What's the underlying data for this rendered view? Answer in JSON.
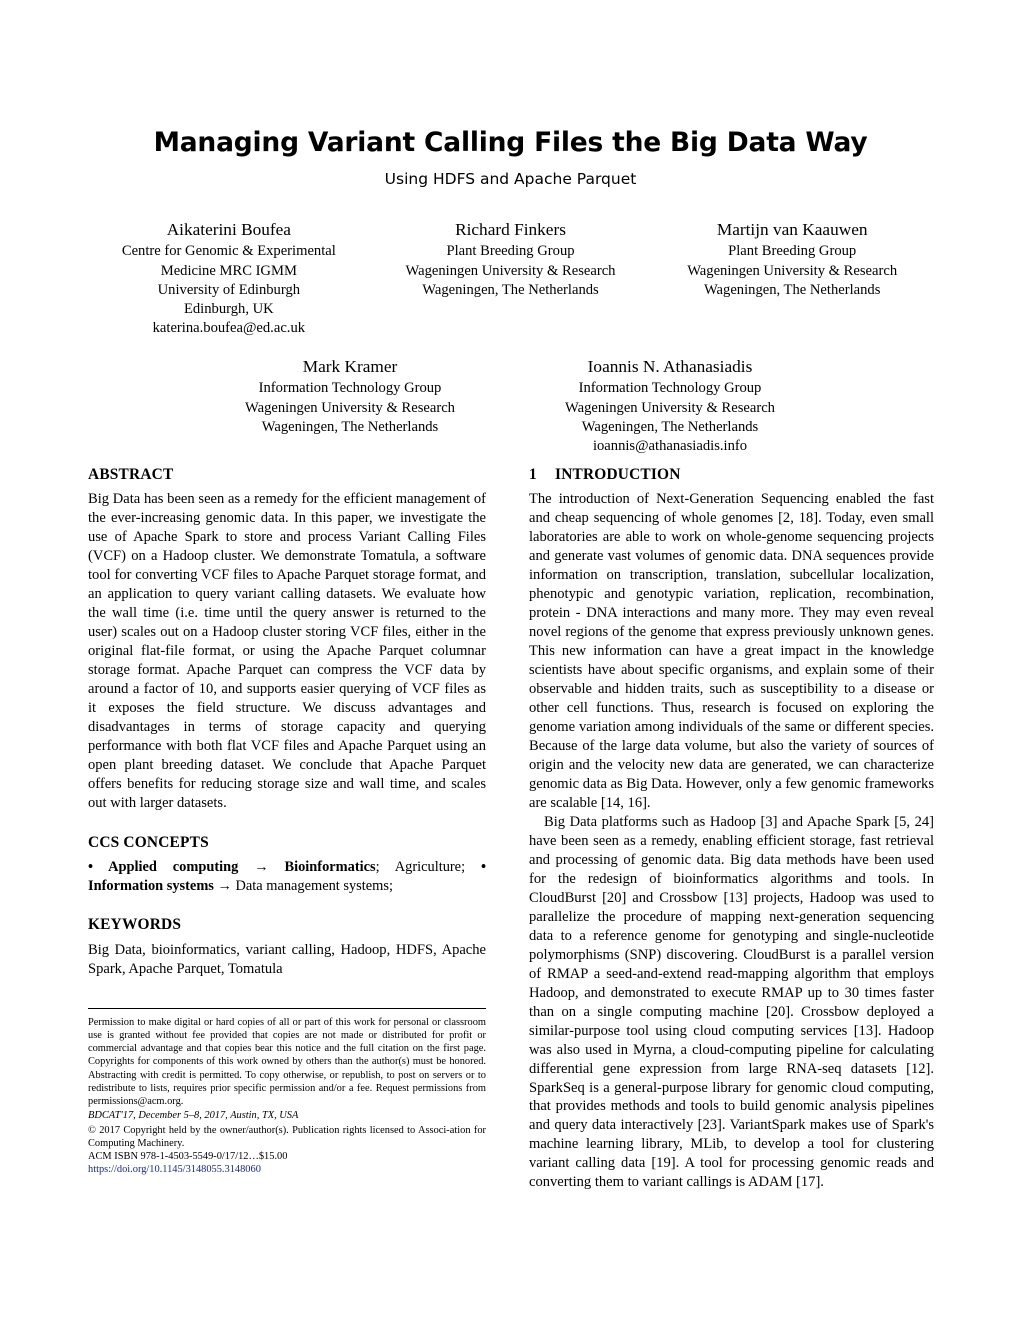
{
  "paper": {
    "title": "Managing Variant Calling Files the Big Data Way",
    "subtitle": "Using HDFS and Apache Parquet"
  },
  "authors_row_1": [
    {
      "name": "Aikaterini Boufea",
      "lines": [
        "Centre for Genomic & Experimental",
        "Medicine MRC IGMM",
        "University of Edinburgh",
        "Edinburgh, UK",
        "katerina.boufea@ed.ac.uk"
      ]
    },
    {
      "name": "Richard Finkers",
      "lines": [
        "Plant Breeding Group",
        "Wageningen University & Research",
        "Wageningen, The Netherlands"
      ]
    },
    {
      "name": "Martijn van Kaauwen",
      "lines": [
        "Plant Breeding Group",
        "Wageningen University & Research",
        "Wageningen, The Netherlands"
      ]
    }
  ],
  "authors_row_2": [
    {
      "name": "Mark Kramer",
      "lines": [
        "Information Technology Group",
        "Wageningen University & Research",
        "Wageningen, The Netherlands"
      ]
    },
    {
      "name": "Ioannis N. Athanasiadis",
      "lines": [
        "Information Technology Group",
        "Wageningen University & Research",
        "Wageningen, The Netherlands",
        "ioannis@athanasiadis.info"
      ]
    }
  ],
  "abstract": {
    "heading": "ABSTRACT",
    "body": "Big Data has been seen as a remedy for the efficient management of the ever-increasing genomic data. In this paper, we investigate the use of Apache Spark to store and process Variant Calling Files (VCF) on a Hadoop cluster. We demonstrate Tomatula, a software tool for converting VCF files to Apache Parquet storage format, and an application to query variant calling datasets. We evaluate how the wall time (i.e. time until the query answer is returned to the user) scales out on a Hadoop cluster storing VCF files, either in the original flat-file format, or using the Apache Parquet columnar storage format. Apache Parquet can compress the VCF data by around a factor of 10, and supports easier querying of VCF files as it exposes the field structure. We discuss advantages and disadvantages in terms of storage capacity and querying performance with both flat VCF files and Apache Parquet using an open plant breeding dataset. We conclude that Apache Parquet offers benefits for reducing storage size and wall time, and scales out with larger datasets."
  },
  "ccs": {
    "heading": "CCS CONCEPTS",
    "part1_bold": "• Applied computing → Bioinformatics",
    "part2_plain": "; Agriculture; ",
    "part3_bold": "• Information systems →",
    "part4_plain": " Data management systems;"
  },
  "keywords": {
    "heading": "KEYWORDS",
    "body": "Big Data, bioinformatics, variant calling, Hadoop, HDFS, Apache Spark, Apache Parquet, Tomatula"
  },
  "introduction": {
    "number": "1",
    "heading": "INTRODUCTION",
    "para1": "The introduction of Next-Generation Sequencing enabled the fast and cheap sequencing of whole genomes [2, 18]. Today, even small laboratories are able to work on whole-genome sequencing projects and generate vast volumes of genomic data. DNA sequences provide information on transcription, translation, subcellular localization, phenotypic and genotypic variation, replication, recombination, protein - DNA interactions and many more. They may even reveal novel regions of the genome that express previously unknown genes. This new information can have a great impact in the knowledge scientists have about specific organisms, and explain some of their observable and hidden traits, such as susceptibility to a disease or other cell functions. Thus, research is focused on exploring the genome variation among individuals of the same or different species. Because of the large data volume, but also the variety of sources of origin and the velocity new data are generated, we can characterize genomic data as Big Data. However, only a few genomic frameworks are scalable [14, 16].",
    "para2": "Big Data platforms such as Hadoop [3] and Apache Spark [5, 24] have been seen as a remedy, enabling efficient storage, fast retrieval and processing of genomic data. Big data methods have been used for the redesign of bioinformatics algorithms and tools. In CloudBurst [20] and Crossbow [13] projects, Hadoop was used to parallelize the procedure of mapping next-generation sequencing data to a reference genome for genotyping and single-nucleotide polymorphisms (SNP) discovering. CloudBurst is a parallel version of RMAP a seed-and-extend read-mapping algorithm that employs Hadoop, and demonstrated to execute RMAP up to 30 times faster than on a single computing machine [20]. Crossbow deployed a similar-purpose tool using cloud computing services [13]. Hadoop was also used in Myrna, a cloud-computing pipeline for calculating differential gene expression from large RNA-seq datasets [12]. SparkSeq is a general-purpose library for genomic cloud computing, that provides methods and tools to build genomic analysis pipelines and query data interactively [23]. VariantSpark makes use of Spark's machine learning library, MLib, to develop a tool for clustering variant calling data [19]. A tool for processing genomic reads and converting them to variant callings is ADAM [17]."
  },
  "footnote": {
    "permission": "Permission to make digital or hard copies of all or part of this work for personal or classroom use is granted without fee provided that copies are not made or distributed for profit or commercial advantage and that copies bear this notice and the full citation on the first page. Copyrights for components of this work owned by others than the author(s) must be honored. Abstracting with credit is permitted. To copy otherwise, or republish, to post on servers or to redistribute to lists, requires prior specific permission and/or a fee. Request permissions from permissions@acm.org.",
    "conference": "BDCAT'17, December 5–8, 2017, Austin, TX, USA",
    "copyright_line1": "© 2017 Copyright held by the owner/author(s). Publication rights licensed to Associ-",
    "copyright_line2": "ation for Computing Machinery.",
    "isbn": "ACM ISBN 978-1-4503-5549-0/17/12…$15.00",
    "doi": "https://doi.org/10.1145/3148055.3148060",
    "link_color": "#1a2a80"
  }
}
